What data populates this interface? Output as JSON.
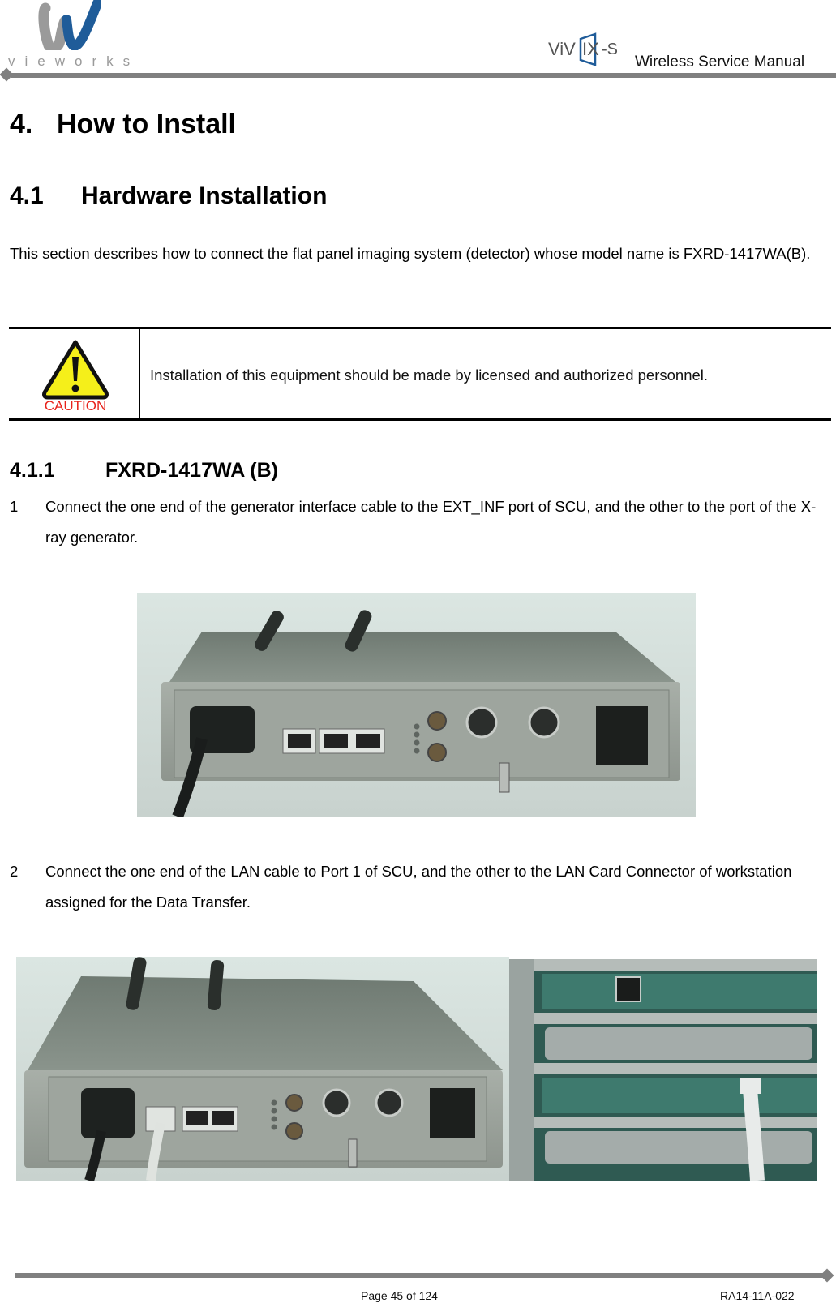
{
  "header": {
    "company_logo_text": "vieworks",
    "product_logo_text": "ViVIX-S",
    "manual_title": "Wireless Service Manual",
    "colors": {
      "logo_blue": "#1f5c99",
      "logo_gray": "#9a9a9a",
      "rule_gray": "#808080"
    }
  },
  "chapter": {
    "number": "4.",
    "title": "How to Install"
  },
  "section": {
    "number": "4.1",
    "title": "Hardware Installation"
  },
  "intro": "This section describes how to connect the flat panel imaging system (detector) whose model name is FXRD-1417WA(B).",
  "caution": {
    "icon": "caution-warning-triangle",
    "icon_label": "CAUTION",
    "text": "Installation of this equipment should be made by licensed and authorized personnel.",
    "colors": {
      "triangle": "#f5ef1a",
      "label": "#e8231c"
    }
  },
  "subsection": {
    "number": "4.1.1",
    "title": "FXRD-1417WA (B)"
  },
  "steps": [
    {
      "number": "1",
      "text": "Connect the one end of the generator interface cable to the EXT_INF port of SCU, and the other to the port of the X-ray generator."
    },
    {
      "number": "2",
      "text": "Connect the one end of the LAN cable to Port 1 of SCU, and the other to the LAN Card Connector of workstation assigned for the Data Transfer."
    }
  ],
  "figures": [
    {
      "description": "SCU rear panel with generator interface cable connected to EXT_INF port"
    },
    {
      "description": "SCU rear panel with LAN cable connected to Port 1"
    },
    {
      "description": "Workstation rear with LAN cable connected to LAN card"
    }
  ],
  "footer": {
    "page_label": "Page 45 of 124",
    "doc_id": "RA14-11A-022"
  }
}
